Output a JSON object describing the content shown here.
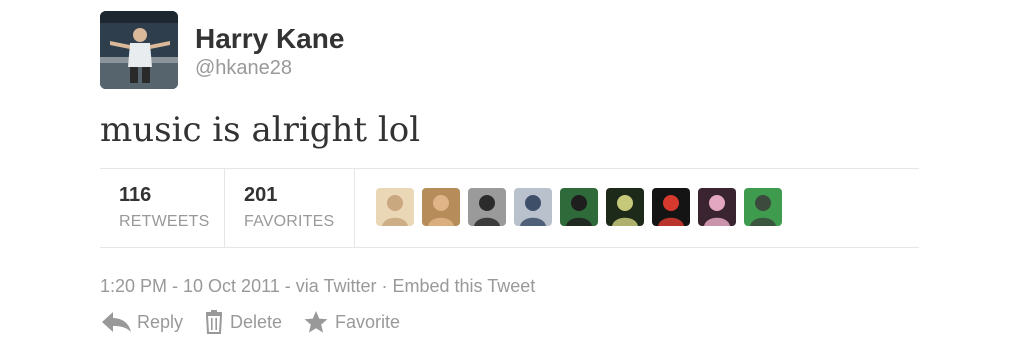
{
  "user": {
    "display_name": "Harry Kane",
    "handle": "@hkane28"
  },
  "tweet": {
    "text": "music is alright lol"
  },
  "stats": {
    "retweets": {
      "count": "116",
      "label": "RETWEETS"
    },
    "favorites": {
      "count": "201",
      "label": "FAVORITES"
    }
  },
  "favoriters": [
    {
      "icon": "user-avatar",
      "bg": "#e9d7b5",
      "face": "#c9a77f"
    },
    {
      "icon": "user-avatar",
      "bg": "#b58c5a",
      "face": "#e0b486"
    },
    {
      "icon": "user-avatar",
      "bg": "#9a9a9a",
      "face": "#2b2b2b"
    },
    {
      "icon": "user-avatar",
      "bg": "#b9c2cc",
      "face": "#3e4f6a"
    },
    {
      "icon": "user-avatar",
      "bg": "#2f6b3a",
      "face": "#1e1e1e"
    },
    {
      "icon": "user-avatar",
      "bg": "#1d2a1a",
      "face": "#c7c97a"
    },
    {
      "icon": "user-avatar",
      "bg": "#141414",
      "face": "#d63a2e"
    },
    {
      "icon": "user-avatar",
      "bg": "#3a2430",
      "face": "#e4a7c2"
    },
    {
      "icon": "user-avatar",
      "bg": "#3f9b4e",
      "face": "#3b4a3c"
    }
  ],
  "meta": {
    "time": "1:20 PM - 10 Oct 2011",
    "via": "via Twitter",
    "separator": "·",
    "embed": "Embed this Tweet"
  },
  "actions": {
    "reply": "Reply",
    "delete": "Delete",
    "favorite": "Favorite"
  },
  "colors": {
    "text": "#333333",
    "muted": "#999999",
    "divider": "#e6e6e6"
  }
}
